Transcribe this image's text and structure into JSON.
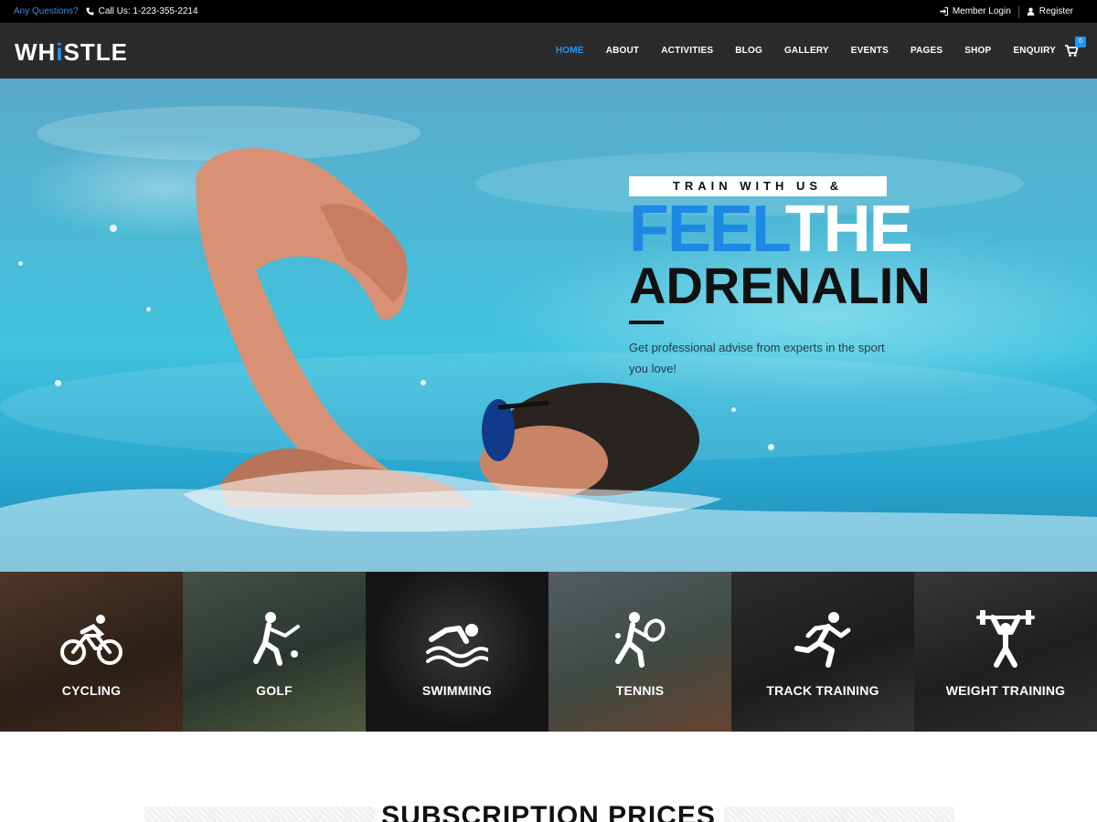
{
  "topbar": {
    "question": "Any Questions?",
    "phone": "Call Us: 1-223-355-2214",
    "login": "Member Login",
    "register": "Register",
    "phone_icon": "phone-icon",
    "login_icon": "sign-in-icon",
    "register_icon": "user-icon"
  },
  "nav": {
    "logo_prefix": "WH",
    "logo_dot": "i",
    "logo_suffix": "STLE",
    "items": [
      "HOME",
      "ABOUT",
      "ACTIVITIES",
      "BLOG",
      "GALLERY",
      "EVENTS",
      "PAGES",
      "SHOP",
      "ENQUIRY"
    ],
    "active": "HOME",
    "cart_count": "0",
    "cart_icon": "cart-icon"
  },
  "hero": {
    "tag": "TRAIN WITH US &",
    "headline_blue": "FEEL",
    "headline_white": "THE",
    "headline_dark": "ADRENALIN",
    "subtitle": "Get professional advise from experts in the sport you love!"
  },
  "activities": [
    {
      "label": "CYCLING",
      "icon": "cycling-icon"
    },
    {
      "label": "GOLF",
      "icon": "golf-icon"
    },
    {
      "label": "SWIMMING",
      "icon": "swimming-icon"
    },
    {
      "label": "TENNIS",
      "icon": "tennis-icon"
    },
    {
      "label": "TRACK TRAINING",
      "icon": "running-icon"
    },
    {
      "label": "WEIGHT TRAINING",
      "icon": "weightlifting-icon"
    }
  ],
  "subscription": {
    "title": "SUBSCRIPTION PRICES"
  },
  "colors": {
    "accent": "#2196f3",
    "topbar": "#000000",
    "navbar": "#2b2b2b"
  }
}
